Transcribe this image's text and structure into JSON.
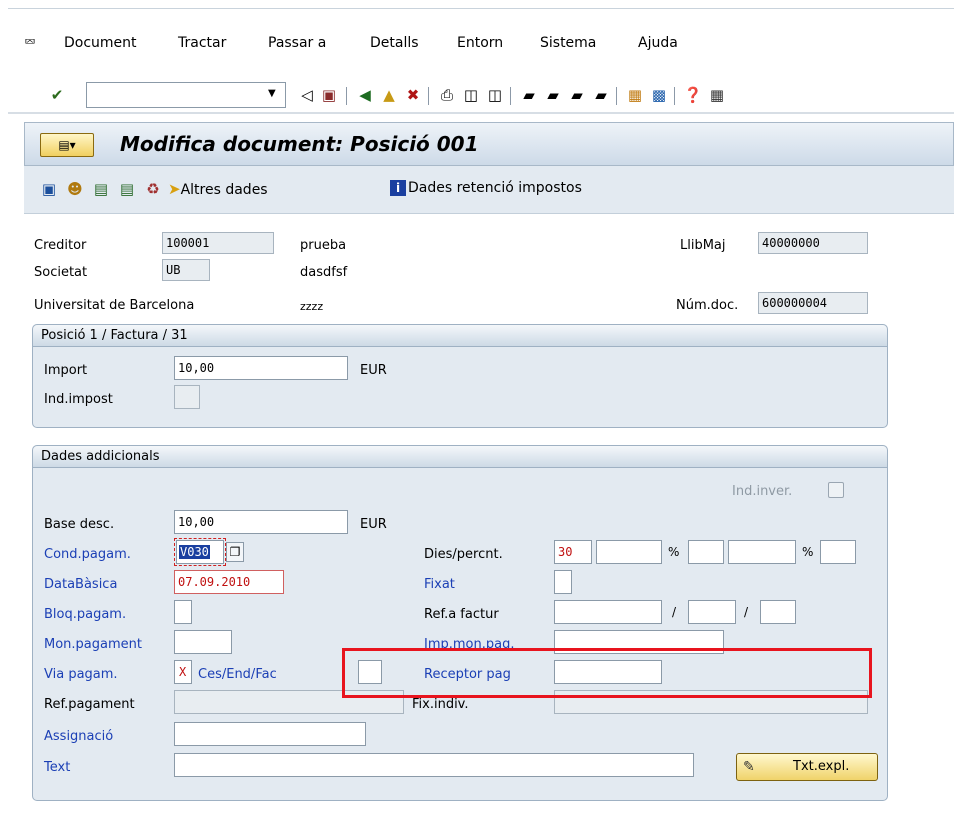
{
  "menu": [
    "Document",
    "Tractar",
    "Passar a",
    "Detalls",
    "Entorn",
    "Sistema",
    "Ajuda"
  ],
  "toolbar": {
    "command_value": ""
  },
  "title": "Modifica document: Posició 001",
  "app_toolbar": {
    "altres_dades": "Altres dades",
    "retencio": "Dades retenció impostos"
  },
  "header": {
    "creditor_label": "Creditor",
    "creditor_value": "100001",
    "creditor_name": "prueba",
    "societat_label": "Societat",
    "societat_value": "UB",
    "societat_name": "dasdfsf",
    "company_name": "Universitat de Barcelona",
    "company_city": "zzzz",
    "llibmaj_label": "LlibMaj",
    "llibmaj_value": "40000000",
    "numdoc_label": "Núm.doc.",
    "numdoc_value": "600000004"
  },
  "group1": {
    "title": "Posició 1 / Factura / 31",
    "import_label": "Import",
    "import_value": "10,00",
    "import_currency": "EUR",
    "indimpost_label": "Ind.impost"
  },
  "group2": {
    "title": "Dades addicionals",
    "indinver_label": "Ind.inver.",
    "base_label": "Base desc.",
    "base_value": "10,00",
    "base_currency": "EUR",
    "cond_label": "Cond.pagam.",
    "cond_value": "V030",
    "data_label": "DataBàsica",
    "data_value": "07.09.2010",
    "bloq_label": "Bloq.pagam.",
    "mon_label": "Mon.pagament",
    "via_label": "Via pagam.",
    "via_value": "X",
    "via_text": "Ces/End/Fac",
    "ref_label": "Ref.pagament",
    "assig_label": "Assignació",
    "text_label": "Text",
    "dies_label": "Dies/percnt.",
    "dies_value": "30",
    "fixat_label": "Fixat",
    "reffactur_label": "Ref.a factur",
    "impmon_label": "Imp.mon.pag.",
    "receptor_label": "Receptor pag",
    "fixindiv_label": "Fix.indiv.",
    "txtexpl_label": "Txt.expl.",
    "pct1": "%",
    "pct2": "%",
    "slash1": "/",
    "slash2": "/"
  }
}
